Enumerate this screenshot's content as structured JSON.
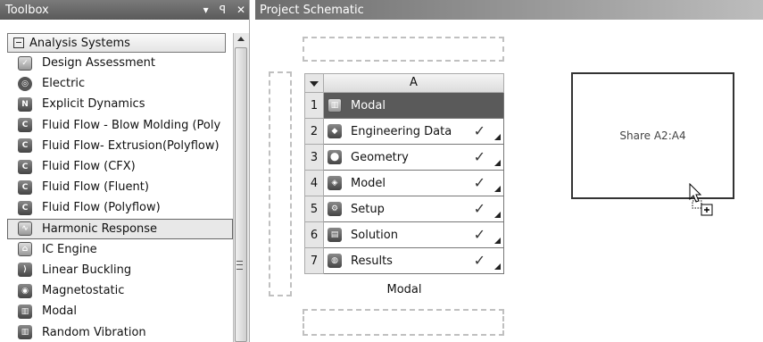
{
  "toolbox": {
    "title": "Toolbox",
    "controls": [
      "▾",
      "ꟼ",
      "✕"
    ],
    "group_label": "Analysis Systems",
    "items": [
      {
        "label": "Design Assessment",
        "icon": "design-assessment-icon"
      },
      {
        "label": "Electric",
        "icon": "electric-icon"
      },
      {
        "label": "Explicit Dynamics",
        "icon": "explicit-dynamics-icon"
      },
      {
        "label": "Fluid Flow - Blow Molding (Poly",
        "icon": "fluid-flow-icon"
      },
      {
        "label": "Fluid Flow- Extrusion(Polyflow)",
        "icon": "fluid-flow-icon"
      },
      {
        "label": "Fluid Flow (CFX)",
        "icon": "fluid-flow-icon"
      },
      {
        "label": "Fluid Flow (Fluent)",
        "icon": "fluid-flow-icon"
      },
      {
        "label": "Fluid Flow (Polyflow)",
        "icon": "fluid-flow-icon"
      },
      {
        "label": "Harmonic Response",
        "icon": "harmonic-response-icon",
        "selected": true
      },
      {
        "label": "IC Engine",
        "icon": "ic-engine-icon"
      },
      {
        "label": "Linear Buckling",
        "icon": "linear-buckling-icon"
      },
      {
        "label": "Magnetostatic",
        "icon": "magnetostatic-icon"
      },
      {
        "label": "Modal",
        "icon": "modal-icon"
      },
      {
        "label": "Random Vibration",
        "icon": "random-vibration-icon"
      }
    ]
  },
  "schematic": {
    "title": "Project Schematic",
    "system": {
      "column_letter": "A",
      "rows": [
        {
          "num": "1",
          "label": "Modal",
          "status": ""
        },
        {
          "num": "2",
          "label": "Engineering Data",
          "status": "✓"
        },
        {
          "num": "3",
          "label": "Geometry",
          "status": "✓"
        },
        {
          "num": "4",
          "label": "Model",
          "status": "✓"
        },
        {
          "num": "5",
          "label": "Setup",
          "status": "✓"
        },
        {
          "num": "6",
          "label": "Solution",
          "status": "✓"
        },
        {
          "num": "7",
          "label": "Results",
          "status": "✓"
        }
      ],
      "name": "Modal"
    },
    "share_box": "Share A2:A4"
  }
}
